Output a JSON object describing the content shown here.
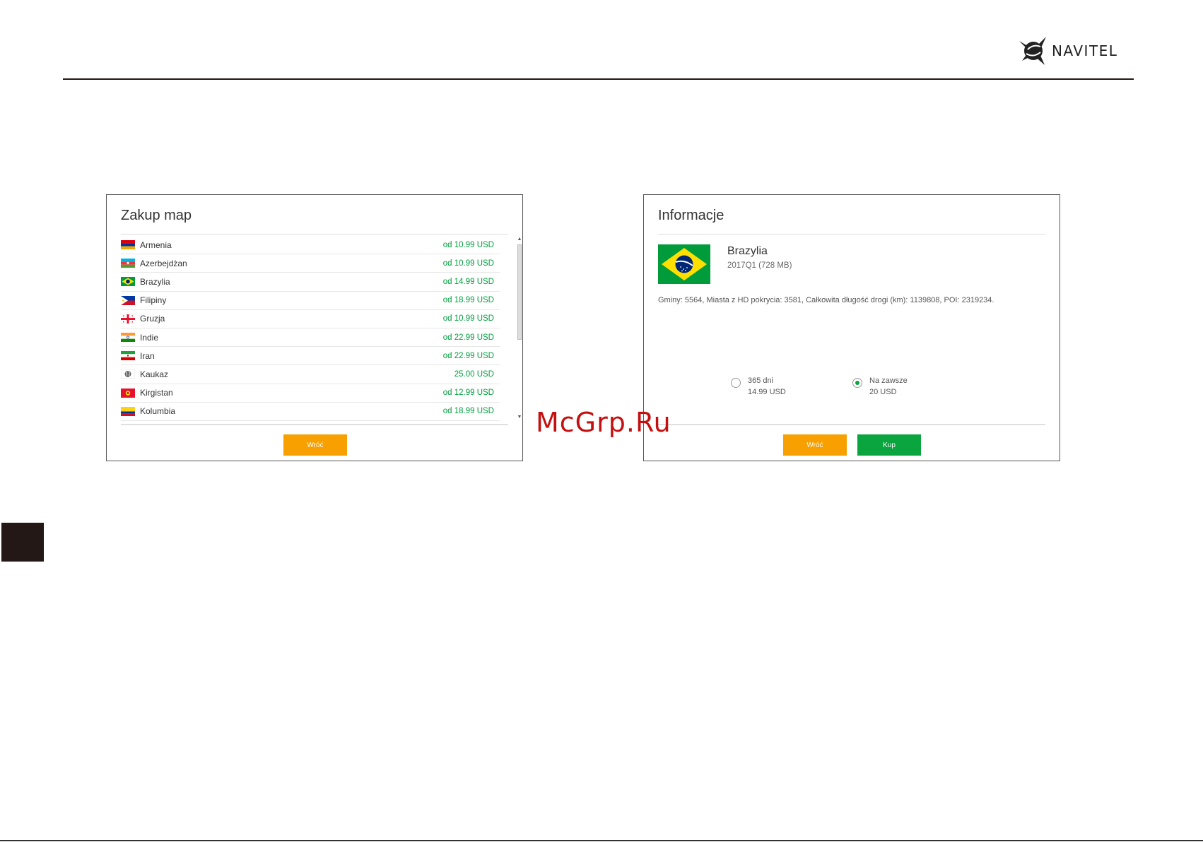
{
  "brand": {
    "name": "NAVITEL",
    "logo_icon": "navitel-bird-icon"
  },
  "watermark": "McGrp.Ru",
  "left_panel": {
    "title": "Zakup map",
    "items": [
      {
        "name": "Armenia",
        "price": "od 10.99 USD",
        "flag": "armenia"
      },
      {
        "name": "Azerbejdżan",
        "price": "od 10.99 USD",
        "flag": "azerbaijan"
      },
      {
        "name": "Brazylia",
        "price": "od 14.99 USD",
        "flag": "brazil"
      },
      {
        "name": "Filipiny",
        "price": "od 18.99 USD",
        "flag": "philippines"
      },
      {
        "name": "Gruzja",
        "price": "od 10.99 USD",
        "flag": "georgia"
      },
      {
        "name": "Indie",
        "price": "od 22.99 USD",
        "flag": "india"
      },
      {
        "name": "Iran",
        "price": "od 22.99 USD",
        "flag": "iran"
      },
      {
        "name": "Kaukaz",
        "price": "25.00 USD",
        "flag": "globe"
      },
      {
        "name": "Kirgistan",
        "price": "od 12.99 USD",
        "flag": "kyrgyzstan"
      },
      {
        "name": "Kolumbia",
        "price": "od 18.99 USD",
        "flag": "colombia"
      }
    ],
    "back_button": "Wróć"
  },
  "right_panel": {
    "title": "Informacje",
    "country": "Brazylia",
    "version": "2017Q1 (728 MB)",
    "stats": "Gminy: 5564, Miasta z HD pokrycia: 3581, Całkowita długość drogi (km): 1139808, POI: 2319234.",
    "options": [
      {
        "period": "365 dni",
        "price": "14.99 USD",
        "selected": false
      },
      {
        "period": "Na zawsze",
        "price": "20 USD",
        "selected": true
      }
    ],
    "back_button": "Wróć",
    "buy_button": "Kup"
  },
  "colors": {
    "price_green": "#00a03e",
    "button_orange": "#f7a000",
    "button_green": "#0aa53e",
    "accent_dark": "#231815"
  }
}
